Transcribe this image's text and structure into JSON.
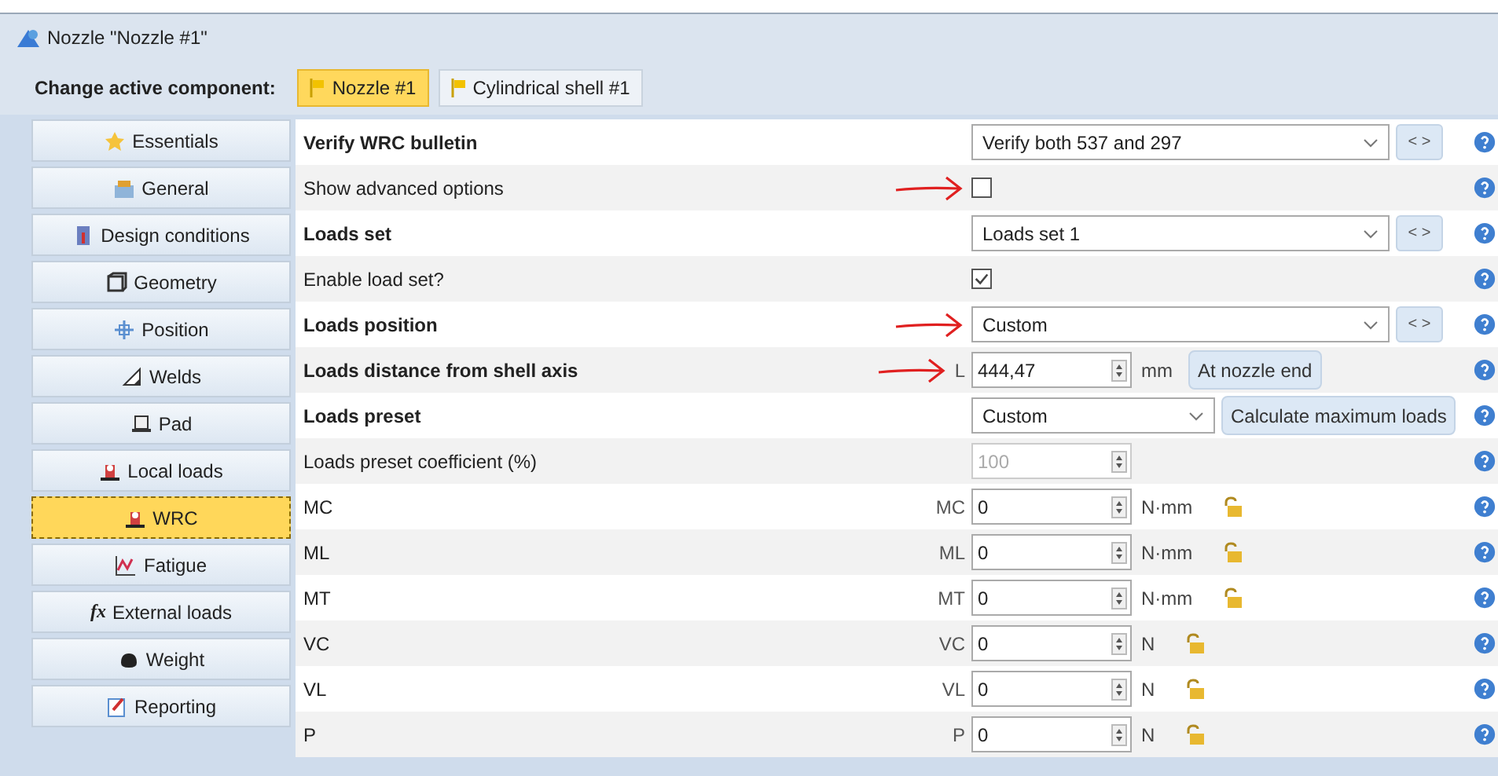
{
  "window": {
    "title": "Nozzle \"Nozzle #1\""
  },
  "component_bar": {
    "label": "Change active component:",
    "components": [
      {
        "label": "Nozzle #1",
        "selected": true
      },
      {
        "label": "Cylindrical shell #1",
        "selected": false
      }
    ]
  },
  "sidebar": {
    "items": [
      {
        "label": "Essentials",
        "selected": false
      },
      {
        "label": "General",
        "selected": false
      },
      {
        "label": "Design conditions",
        "selected": false
      },
      {
        "label": "Geometry",
        "selected": false
      },
      {
        "label": "Position",
        "selected": false
      },
      {
        "label": "Welds",
        "selected": false
      },
      {
        "label": "Pad",
        "selected": false
      },
      {
        "label": "Local loads",
        "selected": false
      },
      {
        "label": "WRC",
        "selected": true
      },
      {
        "label": "Fatigue",
        "selected": false
      },
      {
        "label": "External loads",
        "selected": false,
        "glyph": "fx"
      },
      {
        "label": "Weight",
        "selected": false
      },
      {
        "label": "Reporting",
        "selected": false
      }
    ]
  },
  "properties": [
    {
      "kind": "select",
      "label": "Verify WRC bulletin",
      "bold": true,
      "value": "Verify both 537 and 297",
      "nav": "< >",
      "annotated": false
    },
    {
      "kind": "checkbox",
      "label": "Show advanced options",
      "bold": false,
      "checked": false,
      "annotated": true
    },
    {
      "kind": "select",
      "label": "Loads set",
      "bold": true,
      "value": "Loads set 1",
      "nav": "< >",
      "annotated": false
    },
    {
      "kind": "checkbox",
      "label": "Enable load set?",
      "bold": false,
      "checked": true,
      "annotated": false
    },
    {
      "kind": "select",
      "label": "Loads position",
      "bold": true,
      "value": "Custom",
      "nav": "< >",
      "annotated": true
    },
    {
      "kind": "spin",
      "label": "Loads distance from shell axis",
      "bold": true,
      "symbol": "L",
      "value": "444,47",
      "unit": "mm",
      "button": "At nozzle end",
      "disabled": false,
      "annotated": true
    },
    {
      "kind": "preset",
      "label": "Loads preset",
      "bold": true,
      "value": "Custom",
      "button": "Calculate maximum loads",
      "annotated": false
    },
    {
      "kind": "spin",
      "label": "Loads preset coefficient (%)",
      "bold": false,
      "value": "100",
      "disabled": true,
      "annotated": false
    },
    {
      "kind": "load",
      "label": "MC",
      "bold": false,
      "symbol": "MC",
      "value": "0",
      "unit": "N·mm",
      "annotated": false
    },
    {
      "kind": "load",
      "label": "ML",
      "bold": false,
      "symbol": "ML",
      "value": "0",
      "unit": "N·mm",
      "annotated": false
    },
    {
      "kind": "load",
      "label": "MT",
      "bold": false,
      "symbol": "MT",
      "value": "0",
      "unit": "N·mm",
      "annotated": false
    },
    {
      "kind": "load",
      "label": "VC",
      "bold": false,
      "symbol": "VC",
      "value": "0",
      "unit": "N",
      "annotated": false
    },
    {
      "kind": "load",
      "label": "VL",
      "bold": false,
      "symbol": "VL",
      "value": "0",
      "unit": "N",
      "annotated": false
    },
    {
      "kind": "load",
      "label": "P",
      "bold": false,
      "symbol": "P",
      "value": "0",
      "unit": "N",
      "annotated": false
    }
  ]
}
